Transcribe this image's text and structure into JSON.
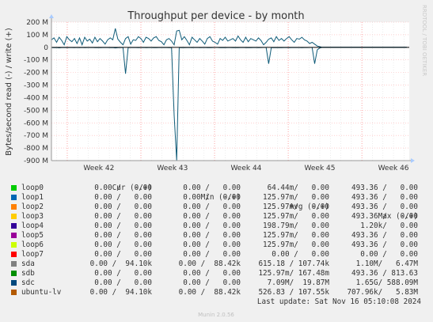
{
  "side_text": "RRDTOOL / TOBI OETIKER",
  "footer_text": "Munin 2.0.56",
  "chart_data": {
    "type": "line",
    "title": "Throughput per device - by month",
    "ylabel": "Bytes/second read (-) / write (+)",
    "ylim": [
      -900000000,
      200000000
    ],
    "yticks": [
      200,
      100,
      0,
      -100,
      -200,
      -300,
      -400,
      -500,
      -600,
      -700,
      -800,
      -900
    ],
    "ytick_labels": [
      "200 M",
      "100 M",
      "0",
      "-100 M",
      "-200 M",
      "-300 M",
      "-400 M",
      "-500 M",
      "-600 M",
      "-700 M",
      "-800 M",
      "-900 M"
    ],
    "x_labels": [
      "Week 42",
      "Week 43",
      "Week 44",
      "Week 45",
      "Week 46"
    ],
    "x_label_days": [
      4.5,
      11.5,
      18.5,
      25.5,
      32.5
    ],
    "x_range_days": [
      0,
      34
    ],
    "x_minor_days": [
      0.5,
      1.5,
      2.5,
      3.5,
      4.5,
      5.5,
      6.5,
      7.5,
      8.5,
      9.5,
      10.5,
      11.5,
      12.5,
      13.5,
      14.5,
      15.5,
      16.5,
      17.5,
      18.5,
      19.5,
      20.5,
      21.5,
      22.5,
      23.5,
      24.5,
      25.5,
      26.5,
      27.5,
      28.5,
      29.5,
      30.5,
      31.5,
      32.5,
      33.5
    ],
    "x_major_days": [
      1.5,
      8.5,
      15.5,
      22.5,
      29.5
    ],
    "grid": true,
    "series": [
      {
        "name": "sdc",
        "color": "#0f5b78",
        "write_mb": [
          60,
          75,
          40,
          80,
          55,
          20,
          85,
          60,
          45,
          70,
          30,
          75,
          20,
          80,
          50,
          65,
          35,
          80,
          45,
          70,
          50,
          25,
          60,
          75,
          60,
          150,
          65,
          40,
          20,
          70,
          85,
          25,
          60,
          55,
          85,
          70,
          40,
          80,
          70,
          50,
          75,
          85,
          55,
          45,
          20,
          60,
          70,
          50,
          20,
          130,
          135,
          60,
          85,
          55,
          20,
          80,
          60,
          40,
          70,
          50,
          25,
          70,
          85,
          50,
          40,
          25,
          70,
          55,
          80,
          50,
          60,
          70,
          50,
          90,
          60,
          40,
          80,
          45,
          70,
          60,
          50,
          75,
          55,
          20,
          40,
          65,
          75,
          45,
          85,
          55,
          70,
          50,
          70,
          85,
          60,
          40,
          70,
          65,
          80,
          60,
          50,
          30,
          40,
          25,
          10,
          5,
          0,
          0,
          0,
          0,
          0,
          0,
          0,
          0,
          0,
          0,
          0,
          0,
          0,
          0,
          0,
          0,
          0,
          0,
          0,
          0,
          0,
          0,
          0,
          0,
          0,
          0,
          0,
          0,
          0,
          0,
          0,
          0,
          0,
          0
        ],
        "read_mb": [
          -2,
          -3,
          -2,
          -4,
          -2,
          -1,
          -3,
          -2,
          -2,
          -3,
          -1,
          -3,
          -1,
          -3,
          -2,
          -2,
          -1,
          -3,
          -2,
          -3,
          -2,
          -1,
          -2,
          -3,
          -2,
          -5,
          -3,
          -2,
          -1,
          -210,
          -3,
          -1,
          -2,
          -2,
          -3,
          -2,
          -1,
          -3,
          -2,
          -2,
          -3,
          -3,
          -2,
          -2,
          -1,
          -2,
          -3,
          -2,
          -540,
          -900,
          -3,
          -2,
          -3,
          -2,
          -1,
          -3,
          -2,
          -1,
          -3,
          -2,
          -1,
          -3,
          -3,
          -2,
          -1,
          -1,
          -3,
          -2,
          -3,
          -2,
          -2,
          -3,
          -2,
          -3,
          -2,
          -1,
          -3,
          -2,
          -3,
          -2,
          -2,
          -3,
          -2,
          -1,
          -1,
          -130,
          -3,
          -2,
          -3,
          -2,
          -3,
          -2,
          -2,
          -3,
          -2,
          -1,
          -2,
          -2,
          -3,
          -2,
          -2,
          -1,
          -1,
          -130,
          -20,
          -5,
          0,
          0,
          0,
          0,
          0,
          0,
          0,
          0,
          0,
          0,
          0,
          0,
          0,
          0,
          0,
          0,
          0,
          0,
          0,
          0,
          0,
          0,
          0,
          0,
          0,
          0,
          0,
          0,
          0,
          0,
          0,
          0,
          0,
          0
        ]
      }
    ]
  },
  "legend": {
    "headers": [
      "Cur (-/+)",
      "Min (-/+)",
      "Avg (-/+)",
      "Max (-/+)"
    ],
    "rows": [
      {
        "name": "loop0",
        "color": "#00cc00",
        "cur": "0.00 /   0.00",
        "min": "0.00 /   0.00",
        "avg": "64.44m/   0.00",
        "max": "493.36 /   0.00"
      },
      {
        "name": "loop1",
        "color": "#0066b3",
        "cur": "0.00 /   0.00",
        "min": "0.00 /   0.00",
        "avg": "125.97m/   0.00",
        "max": "493.36 /   0.00"
      },
      {
        "name": "loop2",
        "color": "#ff8000",
        "cur": "0.00 /   0.00",
        "min": "0.00 /   0.00",
        "avg": "125.97m/   0.00",
        "max": "493.36 /   0.00"
      },
      {
        "name": "loop3",
        "color": "#ffcc00",
        "cur": "0.00 /   0.00",
        "min": "0.00 /   0.00",
        "avg": "125.97m/   0.00",
        "max": "493.36 /   0.00"
      },
      {
        "name": "loop4",
        "color": "#330099",
        "cur": "0.00 /   0.00",
        "min": "0.00 /   0.00",
        "avg": "198.79m/   0.00",
        "max": "1.20k/   0.00"
      },
      {
        "name": "loop5",
        "color": "#990099",
        "cur": "0.00 /   0.00",
        "min": "0.00 /   0.00",
        "avg": "125.97m/   0.00",
        "max": "493.36 /   0.00"
      },
      {
        "name": "loop6",
        "color": "#ccff00",
        "cur": "0.00 /   0.00",
        "min": "0.00 /   0.00",
        "avg": "125.97m/   0.00",
        "max": "493.36 /   0.00"
      },
      {
        "name": "loop7",
        "color": "#ff0000",
        "cur": "0.00 /   0.00",
        "min": "0.00 /   0.00",
        "avg": "0.00 /   0.00",
        "max": "0.00 /   0.00"
      },
      {
        "name": "sda",
        "color": "#808080",
        "cur": "0.00 /  94.10k",
        "min": "0.00 /  88.42k",
        "avg": "615.18 / 107.74k",
        "max": "1.10M/   6.47M"
      },
      {
        "name": "sdb",
        "color": "#008f00",
        "cur": "0.00 /   0.00",
        "min": "0.00 /   0.00",
        "avg": "125.97m/ 167.48m",
        "max": "493.36 / 813.63"
      },
      {
        "name": "sdc",
        "color": "#00487d",
        "cur": "0.00 /   0.00",
        "min": "0.00 /   0.00",
        "avg": "7.09M/  19.87M",
        "max": "1.65G/ 588.09M"
      },
      {
        "name": "ubuntu-lv",
        "color": "#b35a00",
        "cur": "0.00 /  94.10k",
        "min": "0.00 /  88.42k",
        "avg": "526.83 / 107.55k",
        "max": "707.96k/   5.83M"
      }
    ],
    "last_update": "Last update: Sat Nov 16 05:10:08 2024"
  }
}
